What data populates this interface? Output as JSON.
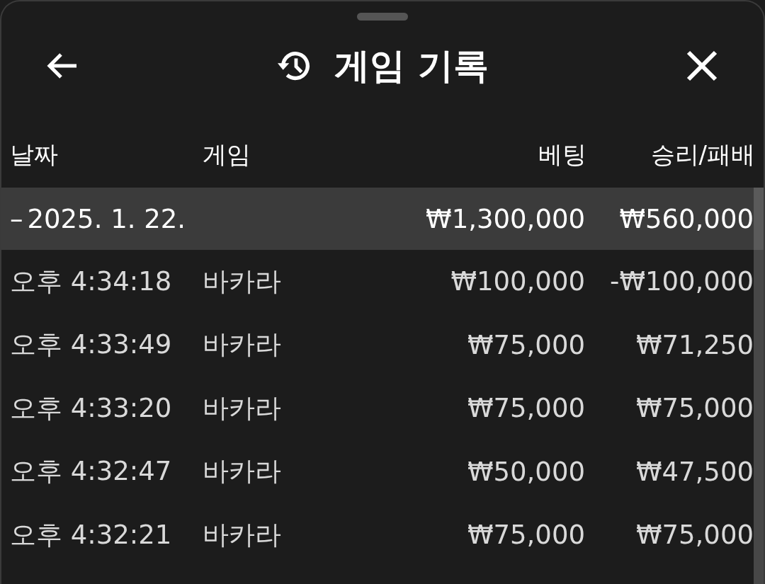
{
  "header": {
    "title": "게임 기록"
  },
  "table": {
    "columns": [
      "날짜",
      "게임",
      "베팅",
      "승리/패배"
    ],
    "group": {
      "toggle": "–",
      "date": "2025. 1. 22.",
      "bet": "₩1,300,000",
      "result": "₩560,000"
    },
    "rows": [
      {
        "time": "오후 4:34:18",
        "game": "바카라",
        "bet": "₩100,000",
        "result": "-₩100,000"
      },
      {
        "time": "오후 4:33:49",
        "game": "바카라",
        "bet": "₩75,000",
        "result": "₩71,250"
      },
      {
        "time": "오후 4:33:20",
        "game": "바카라",
        "bet": "₩75,000",
        "result": "₩75,000"
      },
      {
        "time": "오후 4:32:47",
        "game": "바카라",
        "bet": "₩50,000",
        "result": "₩47,500"
      },
      {
        "time": "오후 4:32:21",
        "game": "바카라",
        "bet": "₩75,000",
        "result": "₩75,000"
      }
    ]
  }
}
